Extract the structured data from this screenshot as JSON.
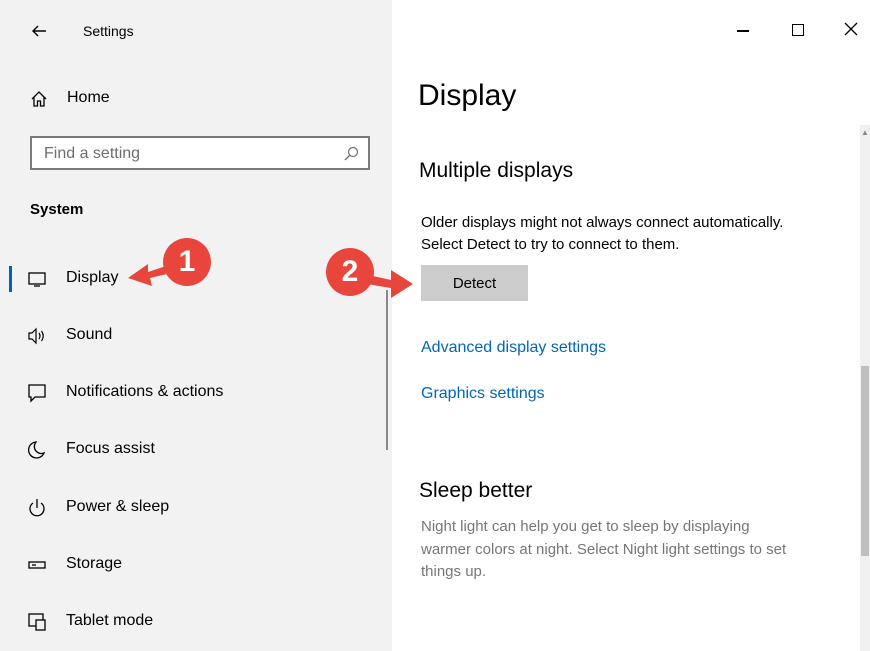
{
  "window": {
    "title": "Settings",
    "back_icon": "arrow-left-icon",
    "minimize_icon": "minimize-icon",
    "maximize_icon": "maximize-icon",
    "close_icon": "close-icon"
  },
  "sidebar": {
    "home_label": "Home",
    "search_placeholder": "Find a setting",
    "section_label": "System",
    "items": [
      {
        "label": "Display",
        "icon": "monitor-icon",
        "selected": true
      },
      {
        "label": "Sound",
        "icon": "speaker-icon"
      },
      {
        "label": "Notifications & actions",
        "icon": "notification-icon"
      },
      {
        "label": "Focus assist",
        "icon": "moon-icon"
      },
      {
        "label": "Power & sleep",
        "icon": "power-icon"
      },
      {
        "label": "Storage",
        "icon": "storage-icon"
      },
      {
        "label": "Tablet mode",
        "icon": "tablet-icon"
      }
    ]
  },
  "main": {
    "page_title": "Display",
    "multiple_displays": {
      "heading": "Multiple displays",
      "description_line1": "Older displays might not always connect automatically.",
      "description_line2": "Select Detect to try to connect to them.",
      "detect_label": "Detect",
      "advanced_link": "Advanced display settings",
      "graphics_link": "Graphics settings"
    },
    "sleep_better": {
      "heading": "Sleep better",
      "line1": "Night light can help you get to sleep by displaying",
      "line2": "warmer colors at night. Select Night light settings to set",
      "line3": "things up."
    }
  },
  "annotations": {
    "step1": "1",
    "step2": "2",
    "color": "#e8453c"
  },
  "colors": {
    "accent": "#0063b1",
    "link": "#0067b8",
    "sidebar_bg": "#f2f2f2"
  }
}
